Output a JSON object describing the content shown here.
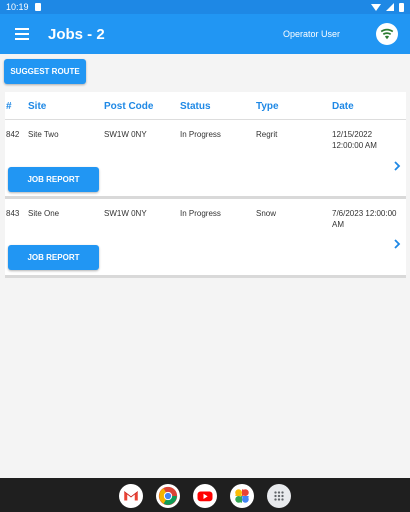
{
  "status_bar": {
    "time": "10:19"
  },
  "app_bar": {
    "title": "Jobs - 2",
    "user": "Operator User"
  },
  "toolbar": {
    "suggest_route_label": "SUGGEST ROUTE"
  },
  "table": {
    "columns": [
      "#",
      "Site",
      "Post Code",
      "Status",
      "Type",
      "Date"
    ],
    "rows": [
      {
        "id": "842",
        "site": "Site Two",
        "post_code": "SW1W 0NY",
        "status": "In Progress",
        "type": "Regrit",
        "date_line1": "12/15/2022",
        "date_line2": "12:00:00 AM",
        "action_label": "JOB REPORT"
      },
      {
        "id": "843",
        "site": "Site One",
        "post_code": "SW1W 0NY",
        "status": "In Progress",
        "type": "Snow",
        "date_line1": "7/6/2023 12:00:00",
        "date_line2": "AM",
        "action_label": "JOB REPORT"
      }
    ]
  },
  "dock": {
    "apps": [
      "gmail-icon",
      "chrome-icon",
      "youtube-icon",
      "photos-icon",
      "app-drawer-icon"
    ]
  },
  "colors": {
    "primary": "#2196f3",
    "header_text": "#1e88e5",
    "connection_ok": "#2e7d32"
  }
}
